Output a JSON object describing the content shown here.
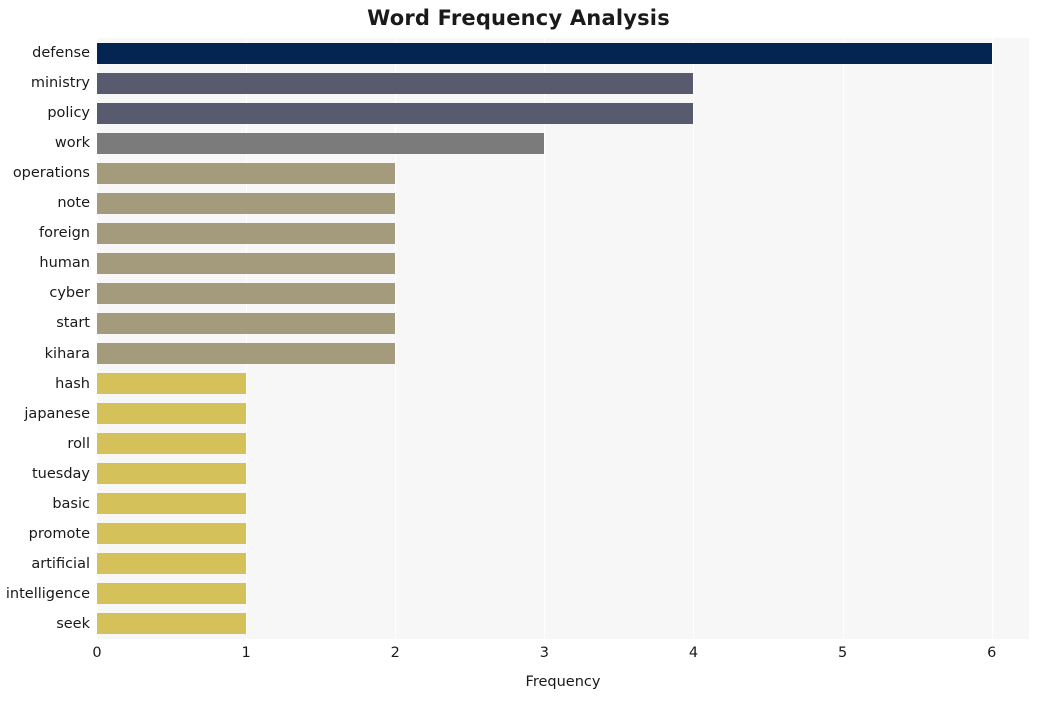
{
  "chart_data": {
    "type": "bar",
    "orientation": "horizontal",
    "title": "Word Frequency Analysis",
    "xlabel": "Frequency",
    "ylabel": "",
    "categories": [
      "defense",
      "ministry",
      "policy",
      "work",
      "operations",
      "note",
      "foreign",
      "human",
      "cyber",
      "start",
      "kihara",
      "hash",
      "japanese",
      "roll",
      "tuesday",
      "basic",
      "promote",
      "artificial",
      "intelligence",
      "seek"
    ],
    "values": [
      6,
      4,
      4,
      3,
      2,
      2,
      2,
      2,
      2,
      2,
      2,
      1,
      1,
      1,
      1,
      1,
      1,
      1,
      1,
      1
    ],
    "bar_colors": [
      "#042552",
      "#575b6d",
      "#575b6d",
      "#7b7b7b",
      "#a39b7b",
      "#a39b7b",
      "#a39b7b",
      "#a39b7b",
      "#a39b7b",
      "#a39b7b",
      "#a39b7b",
      "#d4c15a",
      "#d4c15a",
      "#d4c15a",
      "#d4c15a",
      "#d4c15a",
      "#d4c15a",
      "#d4c15a",
      "#d4c15a",
      "#d4c15a"
    ],
    "xticks": [
      0,
      1,
      2,
      3,
      4,
      5,
      6
    ],
    "xtick_labels": [
      "0",
      "1",
      "2",
      "3",
      "4",
      "5",
      "6"
    ],
    "xlim": [
      0,
      6.25
    ],
    "grid": "vertical",
    "plot_background": "#f7f7f7",
    "grid_color": "#ffffff",
    "legend": null
  }
}
